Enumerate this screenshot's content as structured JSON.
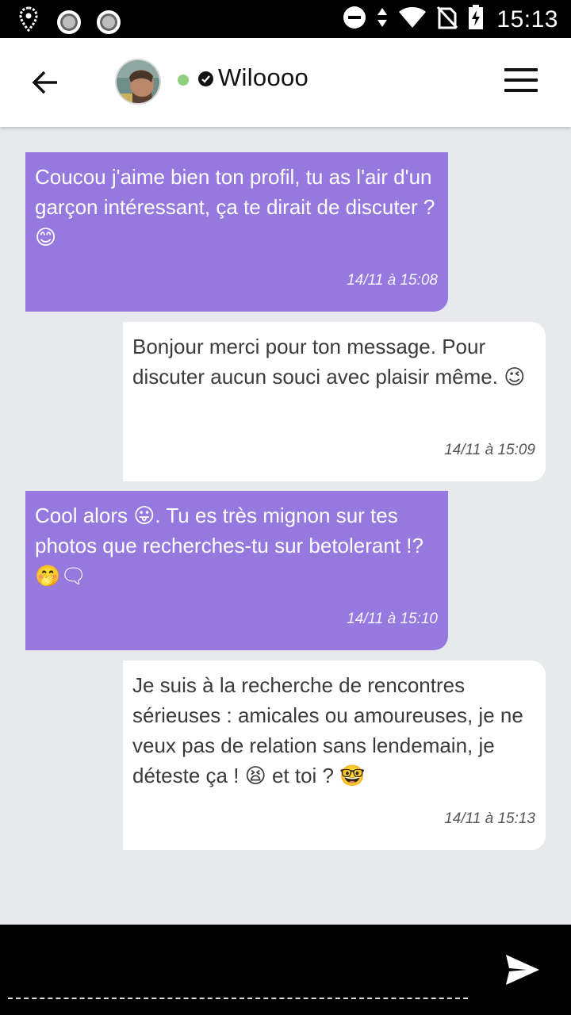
{
  "status_bar": {
    "time": "15:13",
    "icons": [
      "location-icon",
      "notification-circle-icon",
      "notification-circle-icon",
      "dnd-icon",
      "data-arrows-icon",
      "wifi-icon",
      "no-sim-icon",
      "battery-charging-icon"
    ]
  },
  "header": {
    "username": "Wiloooo",
    "online_color": "#8fd07f",
    "icons": [
      "back-arrow-icon",
      "avatar",
      "verified-icon",
      "menu-icon"
    ]
  },
  "messages": [
    {
      "side": "incoming",
      "text": "Coucou j'aime bien ton profil, tu as l'air d'un garçon intéressant, ça te dirait de discuter ? 😊",
      "time": "14/11 à 15:08"
    },
    {
      "side": "outgoing",
      "text": "Bonjour merci pour ton message. Pour discuter aucun souci avec plaisir même. 😉",
      "time": "14/11 à 15:09"
    },
    {
      "side": "incoming",
      "text": "Cool alors 😛. Tu es très mignon sur tes photos que recherches-tu sur betolerant !? 🤭🗨",
      "time": "14/11 à 15:10"
    },
    {
      "side": "outgoing",
      "text": "Je suis à la recherche de rencontres sérieuses : amicales ou amoureuses, je ne veux pas de relation sans lendemain, je déteste ça ! 😫 et toi ? 🤓",
      "time": "14/11 à 15:13"
    }
  ],
  "colors": {
    "incoming_bubble": "#9579df",
    "outgoing_bubble": "#ffffff",
    "background": "#e8e9ed"
  },
  "compose": {
    "value": "",
    "placeholder": ""
  }
}
